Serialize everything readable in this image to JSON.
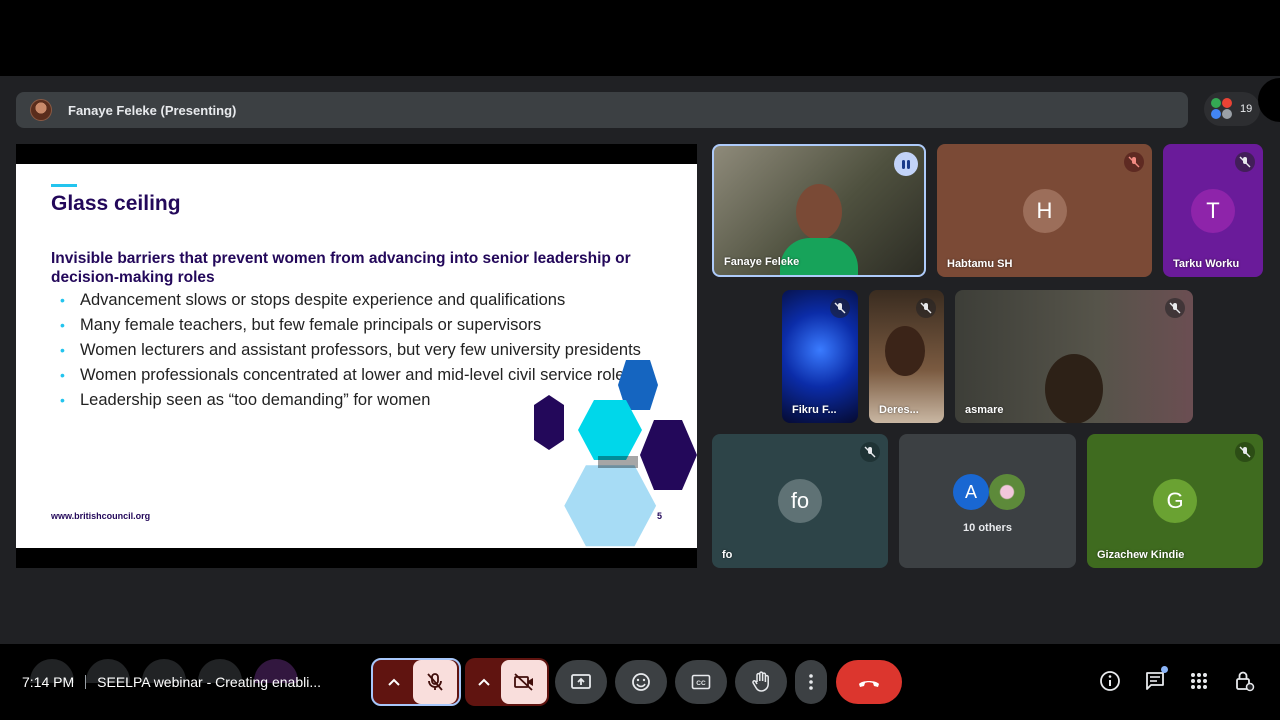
{
  "presenter_bar": {
    "name": "Fanaye Feleke (Presenting)",
    "people_count": "19"
  },
  "slide": {
    "title": "Glass ceiling",
    "subtitle": "Invisible barriers that prevent women from advancing into senior leadership or decision-making roles",
    "bullets": [
      "Advancement slows or stops despite experience and qualifications",
      "Many female teachers, but few female principals or supervisors",
      "Women lecturers and assistant professors, but very few university presidents",
      "Women professionals concentrated at lower and mid-level civil service roles",
      "Leadership seen as “too demanding” for women"
    ],
    "footer_url": "www.britishcouncil.org",
    "page_number": "5",
    "bullet_symbol": "•"
  },
  "participants": [
    {
      "name": "Fanaye Feleke",
      "status": "speaking"
    },
    {
      "name": "Habtamu SH",
      "initial": "H",
      "muted": true,
      "color": "#7b4a36",
      "avatar_color": "#9c6e5a"
    },
    {
      "name": "Tarku Worku",
      "initial": "T",
      "muted": true,
      "color": "#6a1b9a",
      "avatar_color": "#8e24aa"
    },
    {
      "name": "Fikru F...",
      "muted": true
    },
    {
      "name": "Deres...",
      "muted": true
    },
    {
      "name": "asmare",
      "muted": true
    },
    {
      "name": "fo",
      "initial": "fo",
      "muted": true,
      "color": "#2d4448",
      "avatar_color": "#5f7275"
    },
    {
      "name": "10 others",
      "initial": "A",
      "avatar_color": "#1967d2"
    },
    {
      "name": "Gizachew Kindie",
      "initial": "G",
      "muted": true,
      "color": "#3f6b1f",
      "avatar_color": "#6aa232"
    }
  ],
  "bottom_bar": {
    "time": "7:14 PM",
    "meeting_title": "SEELPA webinar - Creating enabli...",
    "mic": "muted",
    "camera": "off"
  },
  "colors": {
    "accent": "#23c4ee",
    "slide_navy": "#23085a",
    "end_call": "#dc362e",
    "muted_control": "#f9dedc"
  }
}
